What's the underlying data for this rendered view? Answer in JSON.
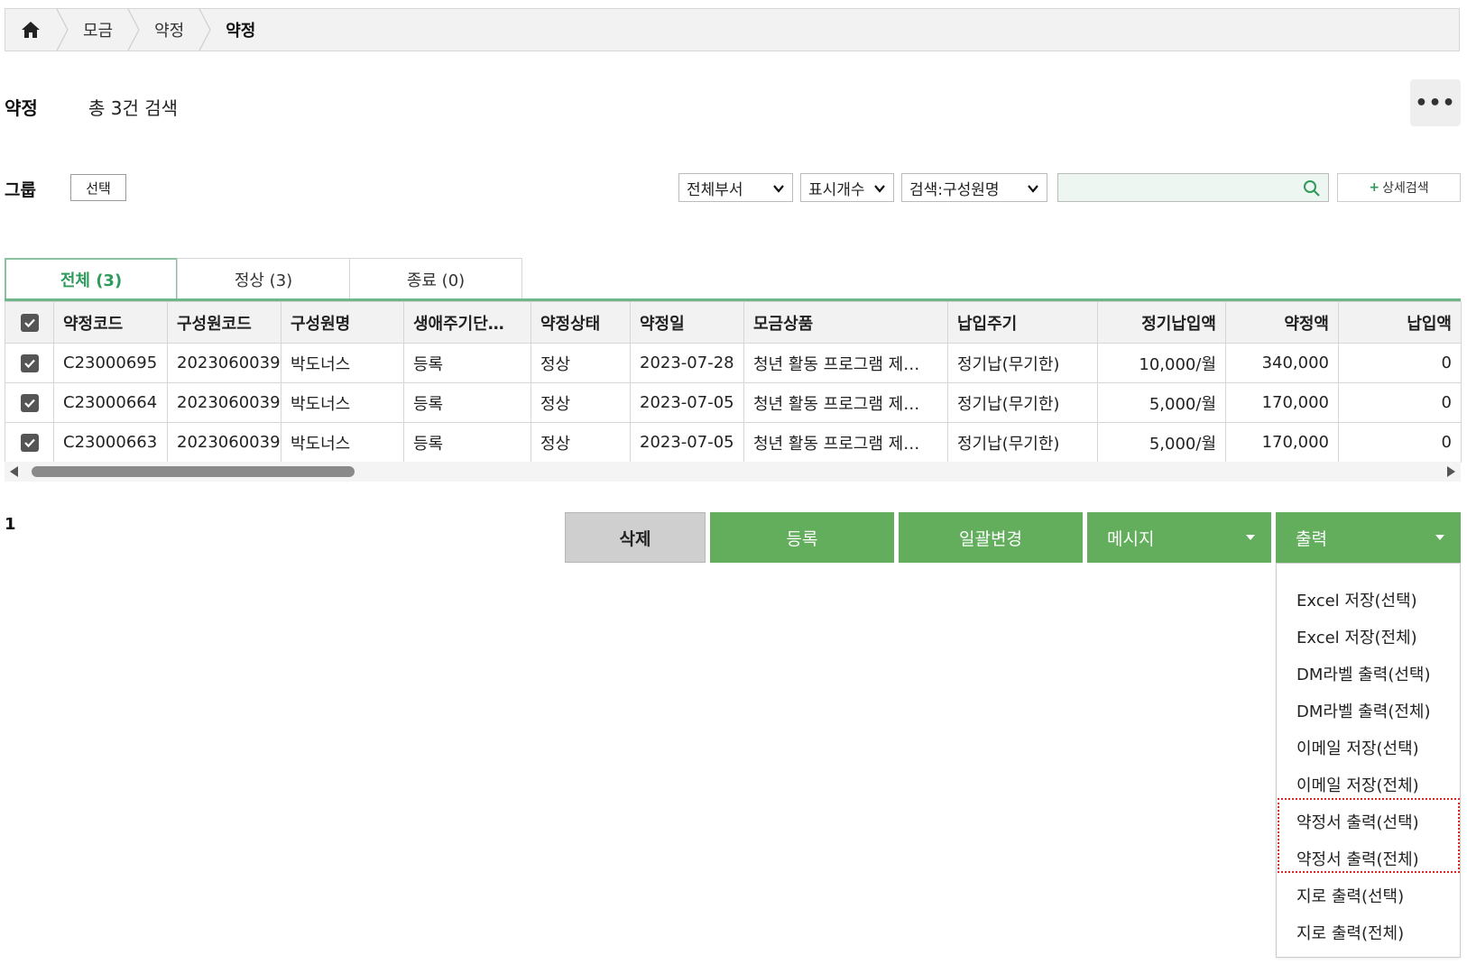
{
  "breadcrumb": {
    "home_icon": "home-icon",
    "items": [
      "모금",
      "약정",
      "약정"
    ]
  },
  "header": {
    "title": "약정",
    "result_count": "총 3건 검색",
    "more_icon": "more-horizontal-icon",
    "more_label": "•••"
  },
  "filters": {
    "group_label": "그룹",
    "group_select_label": "선택",
    "department": "전체부서",
    "display_count": "표시개수",
    "search_type": "검색:구성원명",
    "search_value": "",
    "advanced_search": "상세검색",
    "advanced_search_prefix": "+"
  },
  "tabs": [
    {
      "label": "전체 (3)",
      "active": true
    },
    {
      "label": "정상 (3)",
      "active": false
    },
    {
      "label": "종료 (0)",
      "active": false
    }
  ],
  "table": {
    "columns": [
      "약정코드",
      "구성원코드",
      "구성원명",
      "생애주기단…",
      "약정상태",
      "약정일",
      "모금상품",
      "납입주기",
      "정기납입액",
      "약정액",
      "납입액"
    ],
    "rows": [
      {
        "checked": true,
        "cells": [
          "C23000695",
          "2023060039",
          "박도너스",
          "등록",
          "정상",
          "2023-07-28",
          "청년 활동 프로그램 제…",
          "정기납(무기한)",
          "10,000/월",
          "340,000",
          "0"
        ]
      },
      {
        "checked": true,
        "cells": [
          "C23000664",
          "2023060039",
          "박도너스",
          "등록",
          "정상",
          "2023-07-05",
          "청년 활동 프로그램 제…",
          "정기납(무기한)",
          "5,000/월",
          "170,000",
          "0"
        ]
      },
      {
        "checked": true,
        "cells": [
          "C23000663",
          "2023060039",
          "박도너스",
          "등록",
          "정상",
          "2023-07-05",
          "청년 활동 프로그램 제…",
          "정기납(무기한)",
          "5,000/월",
          "170,000",
          "0"
        ]
      }
    ]
  },
  "pagination": {
    "current": "1"
  },
  "actions": {
    "delete": "삭제",
    "register": "등록",
    "bulk_change": "일괄변경",
    "message": "메시지",
    "print": "출력"
  },
  "print_menu": {
    "items": [
      "Excel 저장(선택)",
      "Excel 저장(전체)",
      "DM라벨 출력(선택)",
      "DM라벨 출력(전체)",
      "이메일 저장(선택)",
      "이메일 저장(전체)",
      "약정서 출력(선택)",
      "약정서 출력(전체)",
      "지로 출력(선택)",
      "지로 출력(전체)"
    ]
  },
  "colors": {
    "accent_green": "#62ae5c",
    "tab_active_text": "#2e9b5c",
    "highlight_red": "#d42a2a"
  }
}
